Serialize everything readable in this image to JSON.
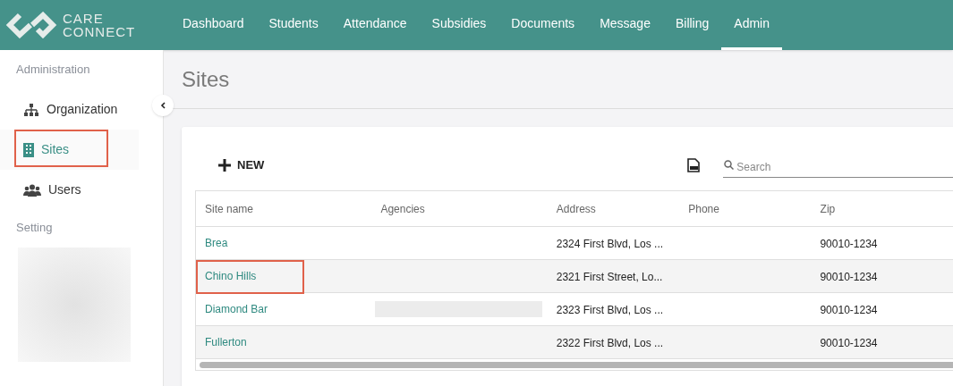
{
  "logo": {
    "line_1": "CARE",
    "line_2": "CONNECT"
  },
  "nav": [
    {
      "label": "Dashboard",
      "selected": false
    },
    {
      "label": "Students",
      "selected": false
    },
    {
      "label": "Attendance",
      "selected": false
    },
    {
      "label": "Subsidies",
      "selected": false
    },
    {
      "label": "Documents",
      "selected": false
    },
    {
      "label": "Message",
      "selected": false
    },
    {
      "label": "Billing",
      "selected": false
    },
    {
      "label": "Admin",
      "selected": true
    }
  ],
  "sidebar": {
    "sections": [
      {
        "title": "Administration",
        "items": [
          {
            "label": "Organization",
            "kind": "org",
            "selected": false,
            "highlighted": false
          },
          {
            "label": "Sites",
            "kind": "building",
            "selected": true,
            "highlighted": true
          },
          {
            "label": "Users",
            "kind": "users",
            "selected": false,
            "highlighted": false
          }
        ]
      },
      {
        "title": "Setting",
        "redacted": true
      }
    ]
  },
  "page_title": "Sites",
  "toolbar": {
    "new_label": "NEW",
    "search": {
      "placeholder": "Search"
    }
  },
  "table": {
    "columns": [
      "Site name",
      "Agencies",
      "Address",
      "Phone",
      "Zip"
    ],
    "rows": [
      {
        "site_name": "Brea",
        "agencies_redacted": false,
        "address": "2324 First Blvd, Los ...",
        "zip": "90010-1234",
        "highlighted": false
      },
      {
        "site_name": "Chino Hills",
        "agencies_redacted": false,
        "address": "2321 First Street, Lo...",
        "zip": "90010-1234",
        "highlighted": true
      },
      {
        "site_name": "Diamond Bar",
        "agencies_redacted": true,
        "address": "2323 First Blvd, Los ...",
        "zip": "90010-1234",
        "highlighted": false
      },
      {
        "site_name": "Fullerton",
        "agencies_redacted": false,
        "address": "2322 First Blvd, Los ...",
        "zip": "90010-1234",
        "highlighted": false
      }
    ]
  }
}
